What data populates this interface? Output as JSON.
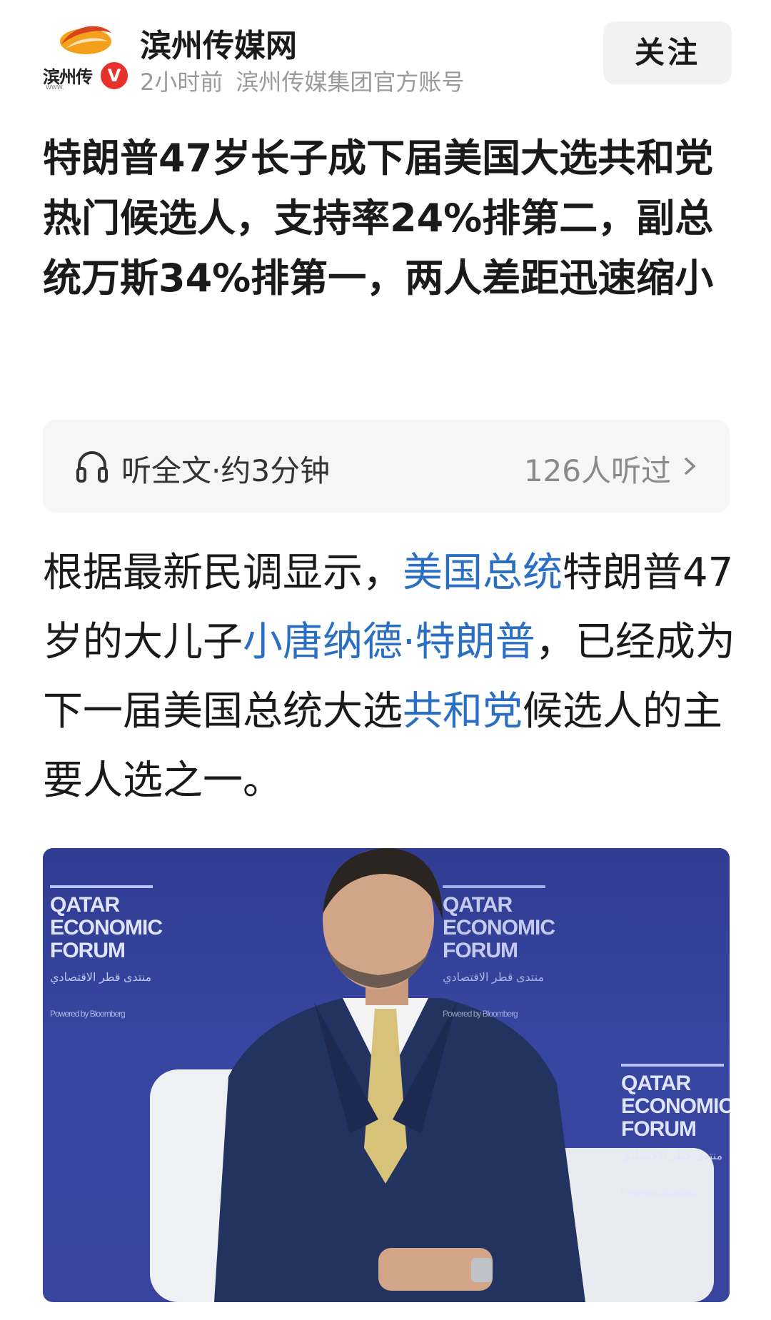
{
  "header": {
    "avatar_text": "滨州传",
    "avatar_sub": "WWW.",
    "verified_badge": "V",
    "account_name": "滨州传媒网",
    "time": "2小时前",
    "account_desc": "滨州传媒集团官方账号",
    "follow_label": "关注"
  },
  "article": {
    "title": "特朗普47岁长子成下届美国大选共和党热门候选人，支持率24%排第二，副总统万斯34%排第一，两人差距迅速缩小",
    "listen_label": "听全文·约3分钟",
    "listen_count": "126人听过",
    "body": [
      {
        "text": "根据最新民调显示，",
        "link": false
      },
      {
        "text": "美国总统",
        "link": true
      },
      {
        "text": "特朗普47岁的大儿子",
        "link": false
      },
      {
        "text": "小唐纳德·特朗普",
        "link": true
      },
      {
        "text": "，已经成为下一届美国总统大选",
        "link": false
      },
      {
        "text": "共和党",
        "link": true
      },
      {
        "text": "候选人的主要人选之一。",
        "link": false
      }
    ]
  },
  "image": {
    "forum_line1": "QATAR",
    "forum_line2": "ECONOMIC",
    "forum_line3": "FORUM",
    "forum_arabic": "منتدى قطر الاقتصادي",
    "forum_powered": "Powered by Bloomberg"
  },
  "colors": {
    "link": "#2a6fc4",
    "badge": "#e8312c",
    "stage_background": "#3a4aa6"
  },
  "icons": {
    "listen": "headphones-icon",
    "more": "chevron-right-icon"
  }
}
